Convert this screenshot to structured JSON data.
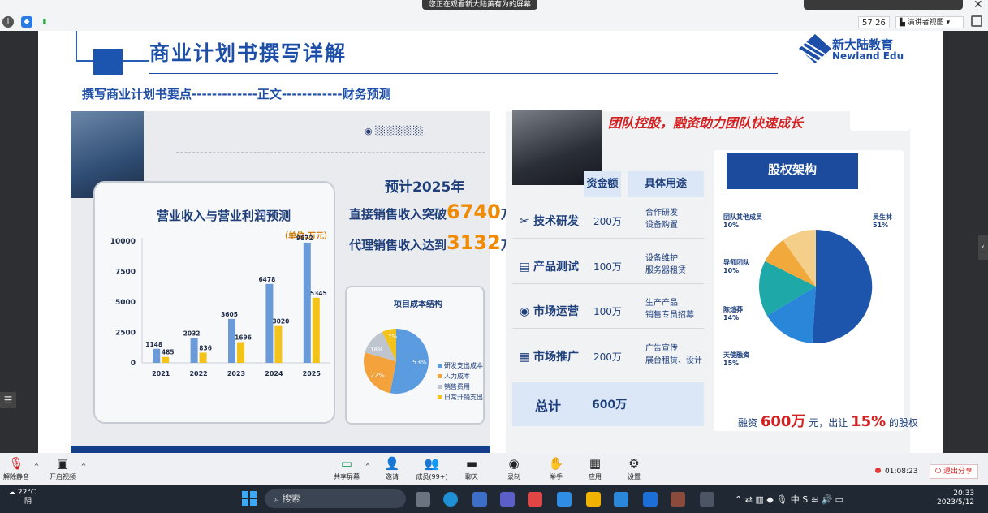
{
  "topbar": {
    "notice": "您正在观看新大陆黄有为的屏幕",
    "timer": "57:26",
    "view_label": "演讲者视图"
  },
  "slide": {
    "title": "商业计划书撰写详解",
    "subtitle": "撰写商业计划书要点-------------正文------------财务预测",
    "logo_cn": "新大陆教育",
    "logo_en": "Newland Edu",
    "left_panel": {
      "chart_title": "营业收入与营业利润预测",
      "unit": "（单位:万元）",
      "forecast_year": "预计2025年",
      "forecast_direct_prefix": "直接销售收入突破",
      "forecast_direct_value": "6740",
      "forecast_direct_unit": "万",
      "forecast_agent_prefix": "代理销售收入达到",
      "forecast_agent_value": "3132",
      "forecast_agent_unit": "万",
      "pie_title": "项目成本结构",
      "pie_labels": [
        "53%",
        "22%",
        "18%",
        "7%"
      ],
      "pie_legend": [
        "研发支出成本",
        "人力成本",
        "销售费用",
        "日常开销支出"
      ]
    },
    "right_panel": {
      "title": "团队控股，融资助力团队快速成长",
      "header_amount": "资金额",
      "header_use": "具体用途",
      "rows": [
        {
          "label": "技术研发",
          "amount": "200万",
          "use1": "合作研发",
          "use2": "设备购置"
        },
        {
          "label": "产品测试",
          "amount": "100万",
          "use1": "设备维护",
          "use2": "服务器租赁"
        },
        {
          "label": "市场运营",
          "amount": "100万",
          "use1": "生产产品",
          "use2": "销售专员招募"
        },
        {
          "label": "市场推广",
          "amount": "200万",
          "use1": "广告宣传",
          "use2": "展台租赁、设计"
        }
      ],
      "total_label": "总计",
      "total_amount": "600万",
      "equity_title": "股权架构",
      "equity_labels": [
        {
          "name": "团队其他成员",
          "pct": "10%"
        },
        {
          "name": "吴生林",
          "pct": "51%"
        },
        {
          "name": "导师团队",
          "pct": "10%"
        },
        {
          "name": "陈煊莽",
          "pct": "14%"
        },
        {
          "name": "天使融资",
          "pct": "15%"
        }
      ],
      "financing_prefix": "融资",
      "financing_amount": "600万",
      "financing_mid": "元，出让",
      "financing_pct": "15%",
      "financing_suffix": "的股权"
    }
  },
  "chart_data": {
    "type": "bar",
    "title": "营业收入与营业利润预测",
    "ylabel": "（单位:万元）",
    "categories": [
      "2021",
      "2022",
      "2023",
      "2024",
      "2025"
    ],
    "yticks": [
      0,
      2500,
      5000,
      7500,
      10000
    ],
    "ylim": [
      0,
      10000
    ],
    "series": [
      {
        "values": [
          1148,
          2032,
          3605,
          6478,
          9872
        ],
        "color": "#6a9bd8"
      },
      {
        "values": [
          485,
          836,
          1696,
          3020,
          5345
        ],
        "color": "#f3c318"
      }
    ],
    "grid": false,
    "legend": "none"
  },
  "toolbar": {
    "mute": "解除静音",
    "video": "开启视频",
    "share": "共享屏幕",
    "invite": "邀请",
    "members": "成员(99+)",
    "chat": "聊天",
    "record": "录制",
    "raise": "举手",
    "apps": "应用",
    "settings": "设置",
    "rec_time": "01:08:23",
    "exit": "退出分享"
  },
  "taskbar": {
    "temp": "22°C",
    "weather": "阴",
    "search": "搜索",
    "ime": "中",
    "time": "20:33",
    "date": "2023/5/12"
  }
}
